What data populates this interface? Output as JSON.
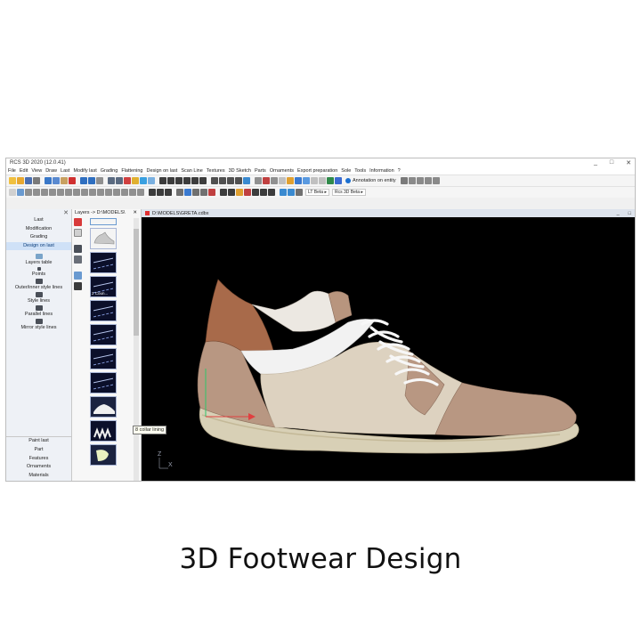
{
  "window": {
    "title": "RCS 3D 2020 (12.0.41)",
    "controls": [
      "_",
      "□",
      "✕"
    ]
  },
  "menu": [
    "File",
    "Edit",
    "View",
    "Draw",
    "Last",
    "Modify last",
    "Grading",
    "Flattening",
    "Design on last",
    "Scan Line",
    "Textures",
    "3D Sketch",
    "Parts",
    "Ornaments",
    "Export preparation",
    "Sole",
    "Tools",
    "Information",
    "?"
  ],
  "toolbar": {
    "annotation_label": "Annotation on entity",
    "lt_beta": "LT Beta ▸",
    "rcs3d_beta": "Rcs 3D Beta ▸"
  },
  "left_nav": {
    "top_items": [
      "Last",
      "Modification",
      "Grading",
      "Design on last"
    ],
    "active_index": 3,
    "tools": [
      "Layers table",
      "Points",
      "Outer/inner style lines",
      "Style lines",
      "Parallel lines",
      "Mirror style lines"
    ],
    "bottom_items": [
      "Paint last",
      "Part",
      "Features",
      "Ornaments",
      "Materials"
    ],
    "close": "✕"
  },
  "layers": {
    "header": "Layers -> D:\\MODELS\\",
    "close": "✕",
    "thumb_label": "2 Coun..."
  },
  "tooltip": "8 collar lining",
  "document": {
    "tab_title": "D:\\MODELS\\GRETA.cdbx",
    "controls": [
      "_",
      "□"
    ],
    "axis_z": "Z",
    "axis_x": "X"
  },
  "colors": {
    "leather_brown": "#a86a4a",
    "taupe": "#b89782",
    "canvas": "#ddd2c0",
    "white_leather": "#f2f2f2",
    "sole": "#d8d0b6",
    "viewport_bg": "#000000",
    "nav_active": "#cfe1f7"
  },
  "caption": "3D Footwear Design"
}
